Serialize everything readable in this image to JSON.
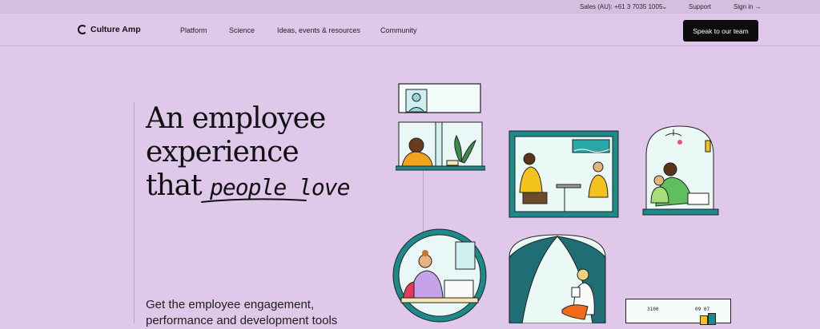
{
  "utility": {
    "sales": "Sales (AU): +61 3 7035 1005",
    "support": "Support",
    "signin": "Sign in →"
  },
  "nav": {
    "brand": "Culture Amp",
    "items": [
      "Platform",
      "Science",
      "Ideas, events & resources",
      "Community"
    ],
    "cta": "Speak to our team"
  },
  "hero": {
    "line1": "An employee",
    "line2": "experience",
    "line3_plain": "that",
    "line3_script": "people love",
    "subtitle": "Get the employee engagement, performance and development tools"
  },
  "illustrations": {
    "panel_text_1": "3100",
    "panel_text_2": "09 07"
  },
  "colors": {
    "bg": "#dfc8ea",
    "cta": "#0c0c0c",
    "teal": "#1c8a8a"
  }
}
